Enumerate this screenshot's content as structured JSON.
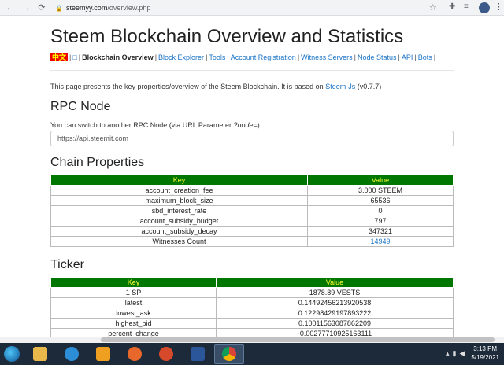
{
  "browser": {
    "url_host": "steemyy.com",
    "url_path": "/overview.php",
    "back_icon": "back-arrow-icon",
    "forward_icon": "forward-arrow-icon",
    "reload_icon": "reload-icon"
  },
  "page": {
    "title": "Steem Blockchain Overview and Statistics",
    "nav": {
      "lang": "中文",
      "box": "□",
      "current": "Blockchain Overview",
      "links": [
        "Block Explorer",
        "Tools",
        "Account Registration",
        "Witness Servers",
        "Node Status",
        "API",
        "Bots"
      ]
    },
    "intro_before": "This page presents the key properties/overview of the Steem Blockchain. It is based on ",
    "intro_link": "Steem-Js",
    "intro_after": " (v0.7.7)",
    "rpc": {
      "heading": "RPC Node",
      "note_before": "You can switch to another RPC Node (via URL Parameter ",
      "note_param": "?node=",
      "note_after": "):",
      "value": "https://api.steemit.com"
    },
    "chain": {
      "heading": "Chain Properties",
      "col_key": "Key",
      "col_value": "Value",
      "rows": [
        {
          "key": "account_creation_fee",
          "value": "3.000 STEEM"
        },
        {
          "key": "maximum_block_size",
          "value": "65536"
        },
        {
          "key": "sbd_interest_rate",
          "value": "0"
        },
        {
          "key": "account_subsidy_budget",
          "value": "797"
        },
        {
          "key": "account_subsidy_decay",
          "value": "347321"
        },
        {
          "key": "Witnesses Count",
          "value": "14949"
        }
      ]
    },
    "ticker": {
      "heading": "Ticker",
      "col_key": "Key",
      "col_value": "Value",
      "rows": [
        {
          "key": "1 SP",
          "value": "1878.89 VESTS"
        },
        {
          "key": "latest",
          "value": "0.14492456213920538"
        },
        {
          "key": "lowest_ask",
          "value": "0.12298429197893222"
        },
        {
          "key": "highest_bid",
          "value": "0.10011563087862209"
        },
        {
          "key": "percent_change",
          "value": "-0.00277710925163111"
        }
      ]
    }
  },
  "taskbar": {
    "time": "3:13 PM",
    "date": "5/19/2021"
  }
}
